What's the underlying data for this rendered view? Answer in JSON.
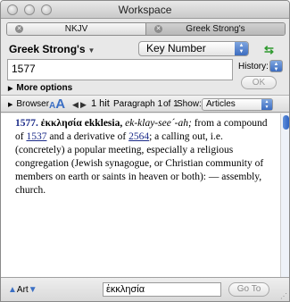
{
  "window": {
    "title": "Workspace"
  },
  "tabs": [
    {
      "label": "NKJV",
      "active": false
    },
    {
      "label": "Greek Strong's",
      "active": true
    }
  ],
  "lookup": {
    "source": "Greek Strong's",
    "key_type": "Key Number",
    "query": "1577",
    "history_label": "History:",
    "ok_label": "OK",
    "more_options_label": "More options"
  },
  "browser": {
    "label": "Browser",
    "aa_small": "A",
    "aa_large": "A",
    "hits": "1 hit",
    "paragraph": "Paragraph 1",
    "of": "of 1",
    "show_label": "Show:",
    "show_value": "Articles"
  },
  "entry": {
    "number": "1577.",
    "greek": "ἐκκλησία",
    "translit": "ekklesia,",
    "pronunciation": "ek-klay-see´-ah;",
    "text1": " from a compound of ",
    "ref1": "1537",
    "text2": " and a derivative of ",
    "ref2": "2564",
    "text3": "; a calling out, i.e. (concretely) a popular meeting, especially a religious congregation (Jewish synagogue, or Christian community of members on earth or saints in heaven or both): — assembly, church."
  },
  "footer": {
    "art_label": "Art",
    "search_value": "ἐκκλησία",
    "goto_label": "Go To"
  },
  "colors": {
    "accent_blue": "#3b6fc4",
    "link": "#1d2d8a",
    "sync_icon": "#2f9a2f"
  },
  "icons": [
    "close-icon",
    "dropdown-triangle-icon",
    "popup-arrows-icon",
    "link-sync-icon",
    "disclosure-triangle-icon",
    "text-size-icon",
    "nav-left-icon",
    "nav-right-icon",
    "scroll-up-icon",
    "scroll-down-icon",
    "resize-grip-icon"
  ]
}
